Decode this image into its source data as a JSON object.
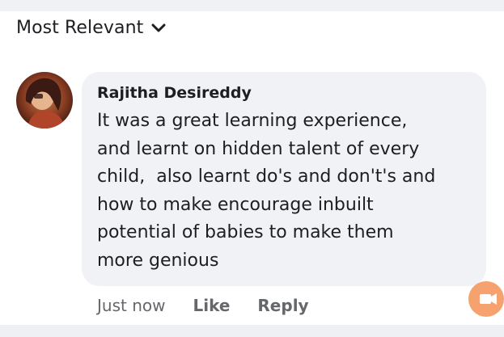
{
  "sort": {
    "label": "Most Relevant"
  },
  "comment": {
    "author": "Rajitha Desireddy",
    "text": "It was a great learning experience,\nand learnt on hidden talent of every\nchild,  also learnt do's and don't's and\nhow to make encourage inbuilt\npotential of babies to make them\nmore genious",
    "avatar_icon": "profile-photo",
    "bubble_color": "#f0f2f5"
  },
  "actions": {
    "time": "Just now",
    "like_label": "Like",
    "reply_label": "Reply"
  },
  "badge": {
    "icon": "video-camera-icon",
    "color": "#f5a26e"
  }
}
